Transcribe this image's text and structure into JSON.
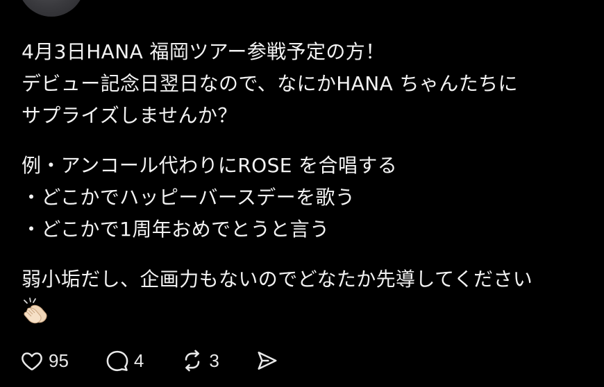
{
  "post": {
    "line1": "4月3日HANA 福岡ツアー参戦予定の方！",
    "line2": "デビュー記念日翌日なので、なにかHANA ちゃんたちに",
    "line3": "サプライズしませんか？",
    "line4": "例・アンコール代わりにROSE を合唱する",
    "line5": "・どこかでハッピーバースデーを歌う",
    "line6": "・どこかで1周年おめでとうと言う",
    "line7": "弱小垢だし、企画力もないのでどなたか先導してください",
    "emoji": "clapping-hands"
  },
  "actions": {
    "like_count": "95",
    "reply_count": "4",
    "repost_count": "3"
  }
}
